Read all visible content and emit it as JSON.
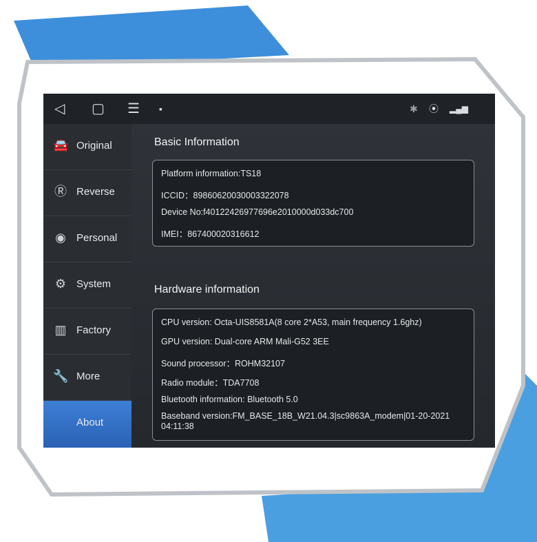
{
  "statusbar": {
    "icons": [
      "back-icon",
      "home-icon",
      "menu-icon",
      "notification-icon",
      "bluetooth-icon",
      "location-icon",
      "signal-icon"
    ]
  },
  "sidebar": {
    "items": [
      {
        "label": "Original",
        "icon": "car-icon"
      },
      {
        "label": "Reverse",
        "icon": "reverse-icon"
      },
      {
        "label": "Personal",
        "icon": "person-icon"
      },
      {
        "label": "System",
        "icon": "gears-icon"
      },
      {
        "label": "Factory",
        "icon": "factory-icon"
      },
      {
        "label": "More",
        "icon": "wrench-icon"
      },
      {
        "label": "About",
        "icon": "info-icon"
      }
    ],
    "active": "About"
  },
  "basic": {
    "title": "Basic Information",
    "rows": [
      "Platform information:TS18",
      "ICCID：89860620030003322078",
      "Device No:f40122426977696e2010000d033dc700",
      "IMEI：867400020316612"
    ]
  },
  "hardware": {
    "title": "Hardware information",
    "rows": [
      "CPU version: Octa-UIS8581A(8 core 2*A53, main frequency 1.6ghz)",
      "GPU version: Dual-core ARM Mali-G52 3EE",
      "Sound processor：ROHM32107",
      "Radio module：TDA7708",
      "Bluetooth information: Bluetooth 5.0",
      "Baseband version:FM_BASE_18B_W21.04.3|sc9863A_modem|01-20-2021 04:11:38"
    ]
  },
  "colors": {
    "accent": "#2f6fcc",
    "decor_blue": "#3b8fd8"
  }
}
